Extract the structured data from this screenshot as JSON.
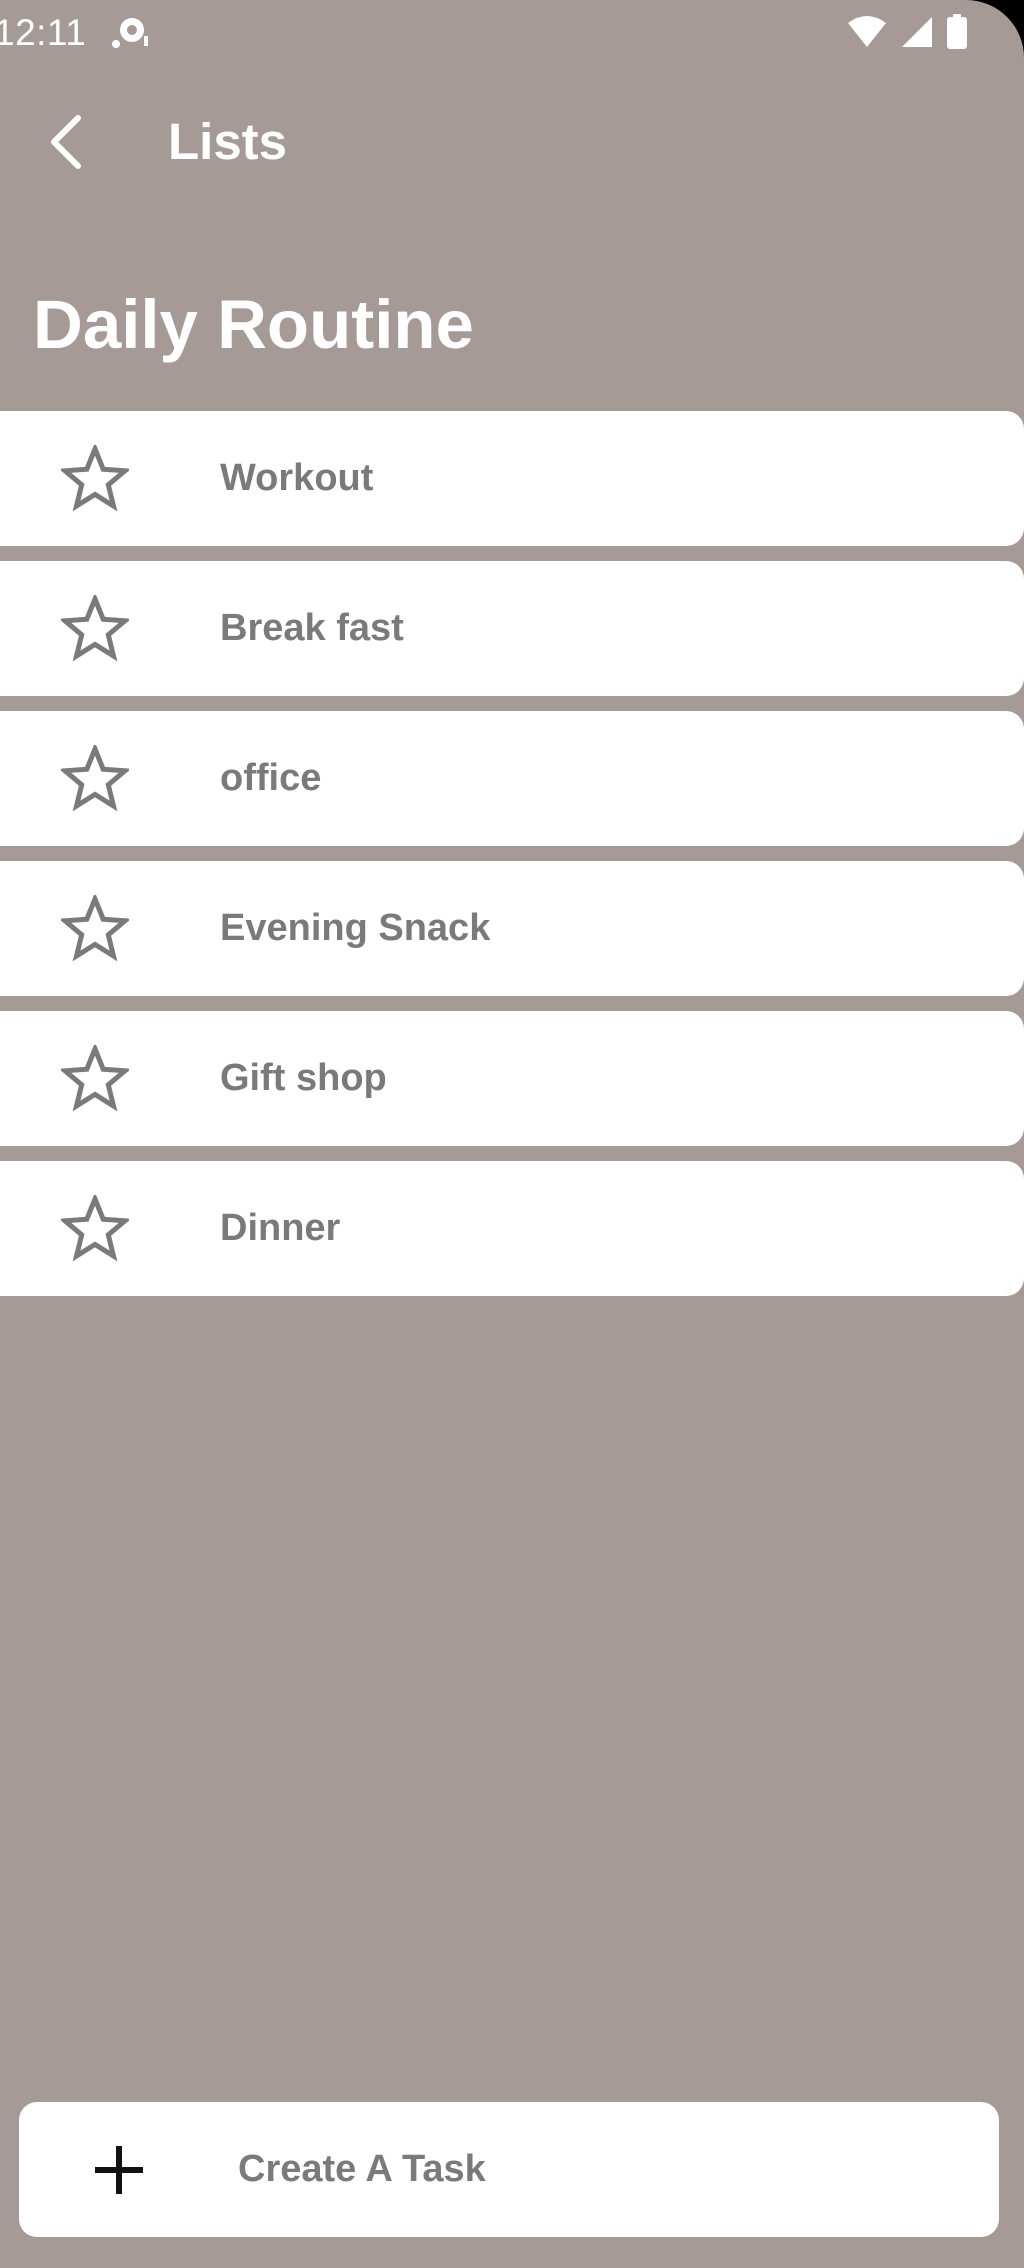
{
  "status_bar": {
    "time": "12:11"
  },
  "app_bar": {
    "title": "Lists"
  },
  "page": {
    "title": "Daily Routine"
  },
  "tasks": [
    {
      "label": "Workout",
      "icon": "star-outline-icon"
    },
    {
      "label": "Break fast",
      "icon": "star-outline-icon"
    },
    {
      "label": "office",
      "icon": "star-outline-icon"
    },
    {
      "label": "Evening Snack",
      "icon": "star-outline-icon"
    },
    {
      "label": "Gift shop",
      "icon": "star-outline-icon"
    },
    {
      "label": "Dinner",
      "icon": "star-outline-icon"
    }
  ],
  "create_task": {
    "label": "Create A Task",
    "icon": "plus-icon"
  },
  "colors": {
    "background": "#a59a96",
    "card": "#ffffff",
    "item_text": "#7a7a7a",
    "title_text": "#ffffff"
  }
}
